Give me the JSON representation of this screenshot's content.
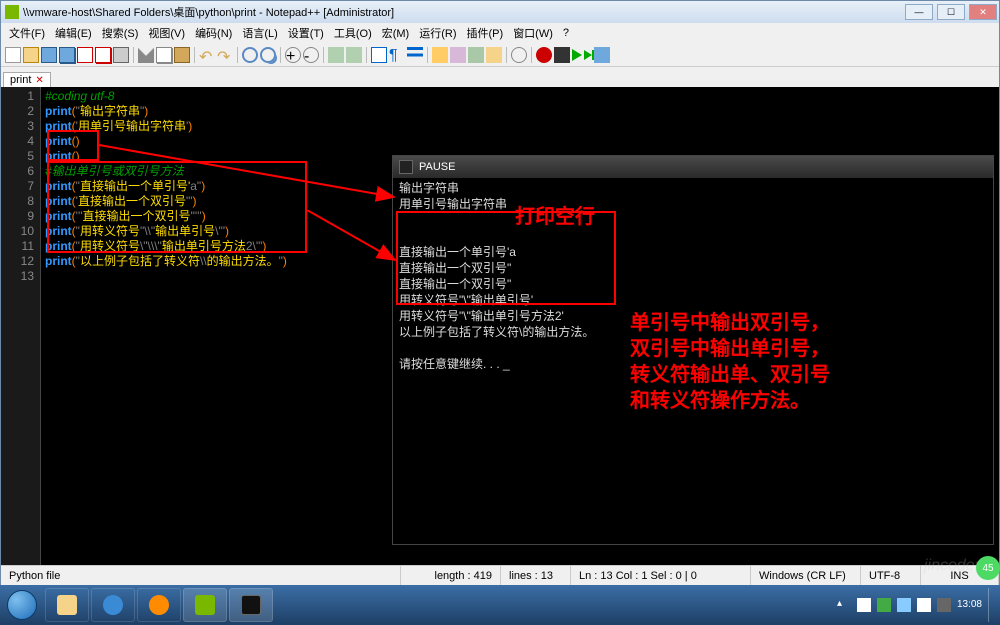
{
  "window": {
    "title": "\\\\vmware-host\\Shared Folders\\桌面\\python\\print - Notepad++ [Administrator]"
  },
  "menu": [
    "文件(F)",
    "编辑(E)",
    "搜索(S)",
    "视图(V)",
    "编码(N)",
    "语言(L)",
    "设置(T)",
    "工具(O)",
    "宏(M)",
    "运行(R)",
    "插件(P)",
    "窗口(W)",
    "?"
  ],
  "tab": {
    "name": "print",
    "close": "✕"
  },
  "code": {
    "lines": [
      {
        "n": "1",
        "segs": [
          {
            "t": "#coding utf-8",
            "c": "cmt"
          }
        ]
      },
      {
        "n": "2",
        "segs": [
          {
            "t": "print",
            "c": "kw"
          },
          {
            "t": "(",
            "c": "op"
          },
          {
            "t": "\"",
            "c": "str"
          },
          {
            "t": "输出字符串",
            "c": "chs"
          },
          {
            "t": "\"",
            "c": "str"
          },
          {
            "t": ")",
            "c": "op"
          }
        ]
      },
      {
        "n": "3",
        "segs": [
          {
            "t": "print",
            "c": "kw"
          },
          {
            "t": "(",
            "c": "op"
          },
          {
            "t": "'",
            "c": "str"
          },
          {
            "t": "用单引号输出字符串",
            "c": "chs"
          },
          {
            "t": "'",
            "c": "str"
          },
          {
            "t": ")",
            "c": "op"
          }
        ]
      },
      {
        "n": "4",
        "segs": [
          {
            "t": "print",
            "c": "kw"
          },
          {
            "t": "()",
            "c": "op"
          }
        ]
      },
      {
        "n": "5",
        "segs": [
          {
            "t": "print",
            "c": "kw"
          },
          {
            "t": "()",
            "c": "op"
          }
        ]
      },
      {
        "n": "6",
        "segs": [
          {
            "t": "#输出单引号或双引号方法",
            "c": "cmt"
          }
        ]
      },
      {
        "n": "7",
        "segs": [
          {
            "t": "print",
            "c": "kw"
          },
          {
            "t": "(",
            "c": "op"
          },
          {
            "t": "\"",
            "c": "str"
          },
          {
            "t": "直接输出一个单引号'",
            "c": "chs"
          },
          {
            "t": "a",
            "c": "str"
          },
          {
            "t": "\"",
            "c": "str"
          },
          {
            "t": ")",
            "c": "op"
          }
        ]
      },
      {
        "n": "8",
        "segs": [
          {
            "t": "print",
            "c": "kw"
          },
          {
            "t": "(",
            "c": "op"
          },
          {
            "t": "'",
            "c": "str"
          },
          {
            "t": "直接输出一个双引号",
            "c": "chs"
          },
          {
            "t": "\"'",
            "c": "str"
          },
          {
            "t": ")",
            "c": "op"
          }
        ]
      },
      {
        "n": "9",
        "segs": [
          {
            "t": "print",
            "c": "kw"
          },
          {
            "t": "(",
            "c": "op"
          },
          {
            "t": "'''",
            "c": "str"
          },
          {
            "t": "直接输出一个双引号",
            "c": "chs"
          },
          {
            "t": "\"'''",
            "c": "str"
          },
          {
            "t": ")",
            "c": "op"
          }
        ]
      },
      {
        "n": "10",
        "segs": [
          {
            "t": "print",
            "c": "kw"
          },
          {
            "t": "(",
            "c": "op"
          },
          {
            "t": "\"",
            "c": "str"
          },
          {
            "t": "用转义符号",
            "c": "chs"
          },
          {
            "t": "\"\\\\\"",
            "c": "str"
          },
          {
            "t": "输出单引号",
            "c": "chs"
          },
          {
            "t": "\\'\"",
            "c": "str"
          },
          {
            "t": ")",
            "c": "op"
          }
        ]
      },
      {
        "n": "11",
        "segs": [
          {
            "t": "print",
            "c": "kw"
          },
          {
            "t": "(",
            "c": "op"
          },
          {
            "t": "\"",
            "c": "str"
          },
          {
            "t": "用转义符号",
            "c": "chs"
          },
          {
            "t": "\\\"\\\\\\\"",
            "c": "str"
          },
          {
            "t": "输出单引号方法",
            "c": "chs"
          },
          {
            "t": "2\\'\"",
            "c": "str"
          },
          {
            "t": ")",
            "c": "op"
          }
        ]
      },
      {
        "n": "12",
        "segs": [
          {
            "t": "print",
            "c": "kw"
          },
          {
            "t": "(",
            "c": "op"
          },
          {
            "t": "\"",
            "c": "str"
          },
          {
            "t": "以上例子包括了转义符",
            "c": "chs"
          },
          {
            "t": "\\\\",
            "c": "str"
          },
          {
            "t": "的输出方法。",
            "c": "chs"
          },
          {
            "t": "\"",
            "c": "str"
          },
          {
            "t": ")",
            "c": "op"
          }
        ]
      },
      {
        "n": "13",
        "segs": []
      }
    ]
  },
  "console": {
    "title": "PAUSE",
    "block1": [
      "输出字符串",
      "用单引号输出字符串"
    ],
    "block2": [
      "直接输出一个单引号'a",
      "直接输出一个双引号\"",
      "直接输出一个双引号\"",
      "用转义符号\"\\\"输出单引号'",
      "用转义符号\"\\\"输出单引号方法2'",
      "以上例子包括了转义符\\的输出方法。"
    ],
    "prompt": "请按任意键继续. . . _"
  },
  "annotation": {
    "a1": "打印空行",
    "a2": "单引号中输出双引号，\n双引号中输出单引号，\n转义符输出单、双引号\n和转义符操作方法。"
  },
  "status": {
    "filetype": "Python file",
    "length": "length : 419",
    "lines": "lines : 13",
    "pos": "Ln : 13    Col : 1    Sel : 0 | 0",
    "eol": "Windows (CR LF)",
    "enc": "UTF-8",
    "mode": "INS"
  },
  "taskbar": {
    "time": "13:08"
  },
  "greendot": "45"
}
